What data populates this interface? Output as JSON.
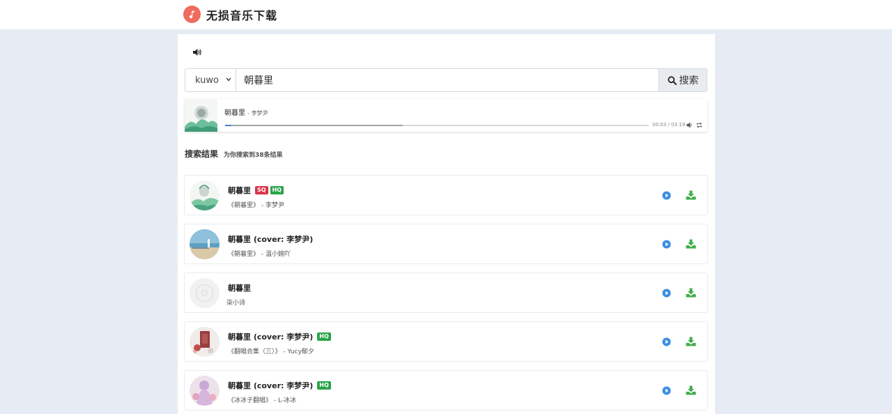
{
  "app": {
    "title": "无损音乐下载",
    "accent": "#ef6b5d"
  },
  "search": {
    "source_selected": "kuwo",
    "query": "朝暮里",
    "button_label": "搜索"
  },
  "player": {
    "title": "朝暮里",
    "artist": "李梦尹",
    "time": "00:03 / 03:19",
    "progress_fraction": 0.015,
    "buffered_fraction": 0.42
  },
  "results": {
    "title": "搜索结果",
    "count_text": "为你搜索到38条结果",
    "items": [
      {
        "title": "朝暮里",
        "badges": [
          "SQ",
          "HQ"
        ],
        "subtitle": "《朝暮里》 - 李梦尹",
        "cover": "landscape-green"
      },
      {
        "title": "朝暮里 (cover: 李梦尹)",
        "badges": [],
        "subtitle": "《朝暮里》 - 温小婉吖",
        "cover": "sea-blue"
      },
      {
        "title": "朝暮里",
        "badges": [],
        "subtitle": "柒小诗",
        "cover": "placeholder-disc"
      },
      {
        "title": "朝暮里 (cover: 李梦尹)",
        "badges": [
          "HQ"
        ],
        "subtitle": "《翻唱合集（三）》 - Yucy郁夕",
        "cover": "red-book"
      },
      {
        "title": "朝暮里 (cover: 李梦尹)",
        "badges": [
          "HQ"
        ],
        "subtitle": "《冰冰子翻唱》 - L-冰冰",
        "cover": "anime-purple"
      }
    ]
  },
  "colors": {
    "play": "#3d8fe0",
    "download": "#3fae49",
    "sq": "#d9364b",
    "hq": "#2aa449"
  }
}
